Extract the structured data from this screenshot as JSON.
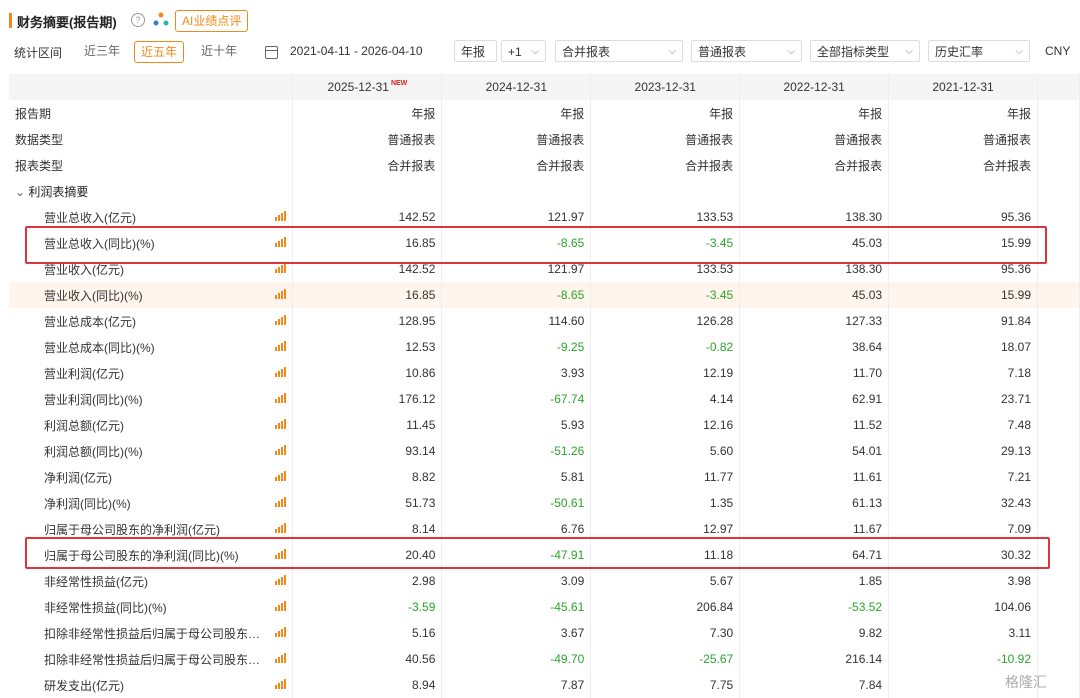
{
  "header": {
    "title": "财务摘要(报告期)",
    "help_icon": "?",
    "ai_button": "AI业绩点评"
  },
  "filters": {
    "period_label": "统计区间",
    "ranges": [
      "近三年",
      "近五年",
      "近十年"
    ],
    "active_range": "近五年",
    "date_range": "2021-04-11  -  2026-04-10",
    "report_type": "年报",
    "plus_one": "+1",
    "consolidation": "合并报表",
    "report_kind": "普通报表",
    "indicator_type": "全部指标类型",
    "fx": "历史汇率",
    "currency": "CNY"
  },
  "table": {
    "columns": [
      "2025-12-31",
      "2024-12-31",
      "2023-12-31",
      "2022-12-31",
      "2021-12-31"
    ],
    "new_tag": "NEW",
    "meta_rows": [
      {
        "label": "报告期",
        "values": [
          "年报",
          "年报",
          "年报",
          "年报",
          "年报"
        ]
      },
      {
        "label": "数据类型",
        "values": [
          "普通报表",
          "普通报表",
          "普通报表",
          "普通报表",
          "普通报表"
        ]
      },
      {
        "label": "报表类型",
        "values": [
          "合并报表",
          "合并报表",
          "合并报表",
          "合并报表",
          "合并报表"
        ]
      }
    ],
    "section_title": "利润表摘要",
    "rows": [
      {
        "label": "营业总收入(亿元)",
        "values": [
          "142.52",
          "121.97",
          "133.53",
          "138.30",
          "95.36"
        ]
      },
      {
        "label": "营业总收入(同比)(%)",
        "values": [
          "16.85",
          "-8.65",
          "-3.45",
          "45.03",
          "15.99"
        ]
      },
      {
        "label": "营业收入(亿元)",
        "values": [
          "142.52",
          "121.97",
          "133.53",
          "138.30",
          "95.36"
        ]
      },
      {
        "label": "营业收入(同比)(%)",
        "values": [
          "16.85",
          "-8.65",
          "-3.45",
          "45.03",
          "15.99"
        ]
      },
      {
        "label": "营业总成本(亿元)",
        "values": [
          "128.95",
          "114.60",
          "126.28",
          "127.33",
          "91.84"
        ]
      },
      {
        "label": "营业总成本(同比)(%)",
        "values": [
          "12.53",
          "-9.25",
          "-0.82",
          "38.64",
          "18.07"
        ]
      },
      {
        "label": "营业利润(亿元)",
        "values": [
          "10.86",
          "3.93",
          "12.19",
          "11.70",
          "7.18"
        ]
      },
      {
        "label": "营业利润(同比)(%)",
        "values": [
          "176.12",
          "-67.74",
          "4.14",
          "62.91",
          "23.71"
        ]
      },
      {
        "label": "利润总额(亿元)",
        "values": [
          "11.45",
          "5.93",
          "12.16",
          "11.52",
          "7.48"
        ]
      },
      {
        "label": "利润总额(同比)(%)",
        "values": [
          "93.14",
          "-51.26",
          "5.60",
          "54.01",
          "29.13"
        ]
      },
      {
        "label": "净利润(亿元)",
        "values": [
          "8.82",
          "5.81",
          "11.77",
          "11.61",
          "7.21"
        ]
      },
      {
        "label": "净利润(同比)(%)",
        "values": [
          "51.73",
          "-50.61",
          "1.35",
          "61.13",
          "32.43"
        ]
      },
      {
        "label": "归属于母公司股东的净利润(亿元)",
        "values": [
          "8.14",
          "6.76",
          "12.97",
          "11.67",
          "7.09"
        ]
      },
      {
        "label": "归属于母公司股东的净利润(同比)(%)",
        "values": [
          "20.40",
          "-47.91",
          "11.18",
          "64.71",
          "30.32"
        ]
      },
      {
        "label": "非经常性损益(亿元)",
        "values": [
          "2.98",
          "3.09",
          "5.67",
          "1.85",
          "3.98"
        ]
      },
      {
        "label": "非经常性损益(同比)(%)",
        "values": [
          "-3.59",
          "-45.61",
          "206.84",
          "-53.52",
          "104.06"
        ]
      },
      {
        "label": "扣除非经常性损益后归属于母公司股东…",
        "values": [
          "5.16",
          "3.67",
          "7.30",
          "9.82",
          "3.11"
        ]
      },
      {
        "label": "扣除非经常性损益后归属于母公司股东…",
        "values": [
          "40.56",
          "-49.70",
          "-25.67",
          "216.14",
          "-10.92"
        ]
      },
      {
        "label": "研发支出(亿元)",
        "values": [
          "8.94",
          "7.87",
          "7.75",
          "7.84",
          ""
        ]
      }
    ]
  },
  "watermark": "格隆汇",
  "colors": {
    "accent": "#f08a1c",
    "negative": "#2aa52a",
    "highlight_box": "#e0343b"
  }
}
